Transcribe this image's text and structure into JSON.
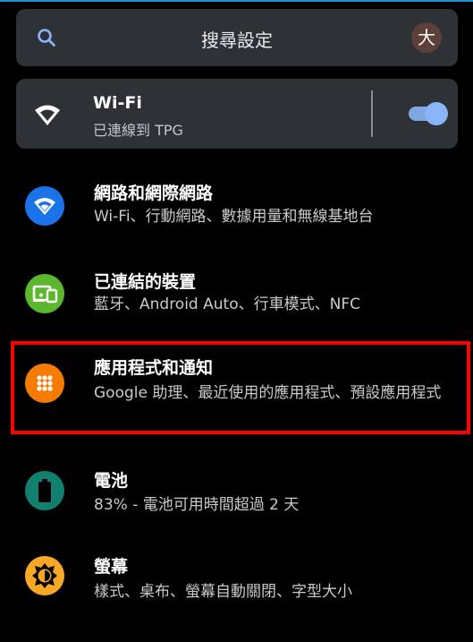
{
  "search": {
    "placeholder": "搜尋設定",
    "avatar_letter": "大",
    "avatar_color": "#5d4037"
  },
  "wifi": {
    "title": "Wi-Fi",
    "subtitle": "已連線到 TPG",
    "toggle_on": true,
    "icon": "wifi-icon"
  },
  "items": [
    {
      "title": "網路和網際網路",
      "subtitle": "Wi-Fi、行動網路、數據用量和無線基地台",
      "icon": "wifi-icon",
      "color": "#1a73e8"
    },
    {
      "title": "已連結的裝置",
      "subtitle": "藍牙、Android Auto、行車模式、NFC",
      "icon": "devices-icon",
      "color": "#5bb82d"
    },
    {
      "title": "應用程式和通知",
      "subtitle": "Google 助理、最近使用的應用程式、預設應用程式",
      "icon": "apps-grid-icon",
      "color": "#f57c00"
    },
    {
      "title": "電池",
      "subtitle": "83% - 電池可用時間超過 2 天",
      "icon": "battery-icon",
      "color": "#12806f"
    },
    {
      "title": "螢幕",
      "subtitle": "樣式、桌布、螢幕自動關閉、字型大小",
      "icon": "brightness-icon",
      "color": "#f9a825"
    }
  ],
  "highlight_color": "#ff0000"
}
